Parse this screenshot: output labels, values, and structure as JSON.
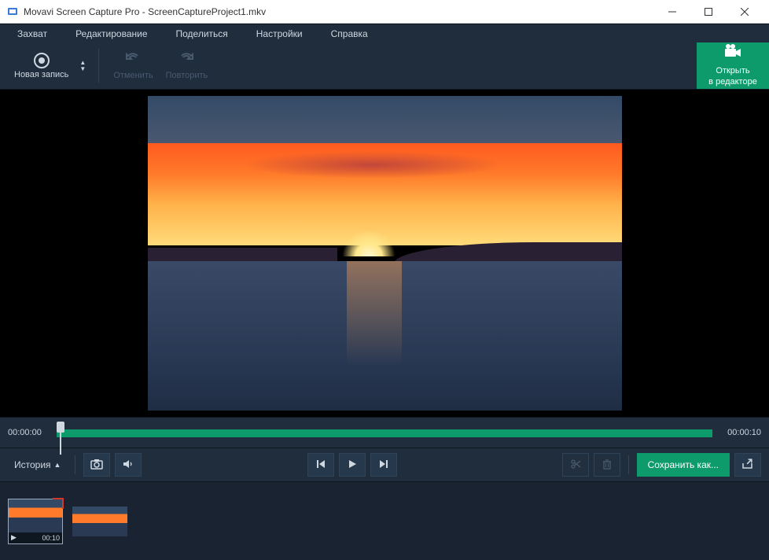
{
  "titlebar": {
    "title": "Movavi Screen Capture Pro - ScreenCaptureProject1.mkv"
  },
  "menubar": {
    "items": [
      "Захват",
      "Редактирование",
      "Поделиться",
      "Настройки",
      "Справка"
    ]
  },
  "toolbar": {
    "new_record": "Новая запись",
    "undo": "Отменить",
    "redo": "Повторить",
    "open_editor_line1": "Открыть",
    "open_editor_line2": "в редакторе"
  },
  "timeline": {
    "start": "00:00:00",
    "end": "00:00:10"
  },
  "controls": {
    "history": "История",
    "save_as": "Сохранить как..."
  },
  "thumbs": {
    "items": [
      {
        "duration": "00:10",
        "active": true,
        "has_play": true
      },
      {
        "duration": "",
        "active": false,
        "has_play": false
      }
    ]
  }
}
